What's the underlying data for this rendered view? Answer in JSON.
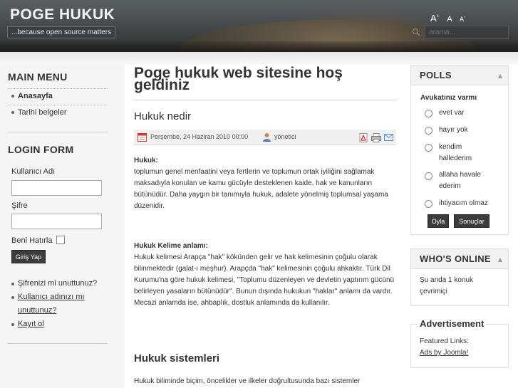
{
  "header": {
    "site_title": "POGE HUKUK",
    "tagline": "...because open source matters",
    "font_bigger": "A",
    "font_reset": "A",
    "font_smaller": "A",
    "font_bigger_sup": "+",
    "font_smaller_sup": "-",
    "search_placeholder": "arama..."
  },
  "main_menu": {
    "title": "MAIN MENU",
    "items": [
      "Anasayfa",
      "Tarihi belgeler"
    ]
  },
  "login_form": {
    "title": "LOGIN FORM",
    "username_label": "Kullanıcı Adı",
    "password_label": "Şifre",
    "remember_label": "Beni Hatırla",
    "submit_label": "Giriş Yap",
    "links": [
      "Şifrenizi mi unuttunuz?",
      "Kullanıcı adınızı mı unuttunuz?",
      "Kayıt ol"
    ]
  },
  "main": {
    "page_title": "Poge hukuk web sitesine hoş geldiniz",
    "article_title": "Hukuk nedir",
    "date": "Perşembe, 24 Haziran 2010 00:00",
    "author": "yönetici",
    "p1_head": "Hukuk:",
    "p1_body": "toplumun genel menfaatini veya fertlerin ve toplumun ortak iyiliğini sağlamak maksadıyla konulan ve kamu gücüyle desteklenen kaide, hak ve kanunların bütünüdür. Daha yaygın bir tanımıyla hukuk, adalete yönelmiş toplumsal yaşama düzenidir.",
    "p2_head": "Hukuk Kelime anlamı:",
    "p2_body": "Hukuk kelimesi Arapça \"hak\" kökünden gelir ve hak kelimesinin çoğulu olarak bilinmektedir (galat-ı meşhur). Arapçda \"hak\" kelimesinin çoğulu ahkaktır. Türk Dil Kurumu'na göre hukuk kelimesi, \"Toplumu düzenleyen ve devletin yaptırım gücünü belirleyen yasaların bütünüdür\". Bunun dışında hukukun \"haklar\" anlamı da vardır. Mecazi anlamda ise, ahbaplık, dostluk anlamında da kullanılır.",
    "h2": "Hukuk sistemleri",
    "p3_body": "Hukuk biliminde biçim, öncelikler ve ilkeler doğrultusunda bazı sistemler"
  },
  "polls": {
    "title": "POLLS",
    "question": "Avukatınız varmı",
    "options": [
      "evet var",
      "hayır yok",
      "kendim hallederim",
      "allaha havale ederim",
      "ihtiyacım olmaz"
    ],
    "vote_label": "Oyla",
    "results_label": "Sonuçlar"
  },
  "whos_online": {
    "title": "WHO'S ONLINE",
    "text": "Şu anda 1 konuk çevrimiçi"
  },
  "advertisement": {
    "title": "Advertisement",
    "label": "Featured Links:",
    "link": "Ads by Joomla!"
  },
  "colors": {
    "header_dark": "#2e3031",
    "sidebar_bg": "#f5f5f5",
    "button_bg": "#3c3c3c"
  }
}
